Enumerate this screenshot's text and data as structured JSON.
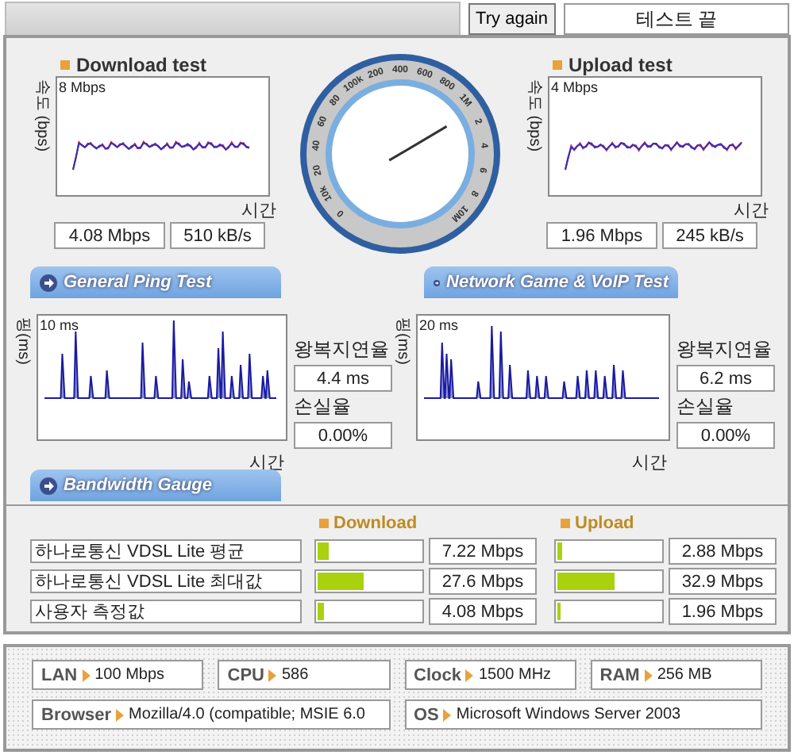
{
  "top_bar": {
    "retry_button": "Try again",
    "status": "테스트 끝"
  },
  "download": {
    "title": "Download test",
    "ylabel": "속도 (bps)",
    "scale": "8 Mbps",
    "xlabel": "시간",
    "rate": "4.08 Mbps",
    "bytes": "510 kB/s"
  },
  "gauge": {
    "labels": [
      "0",
      "10k",
      "20",
      "40",
      "60",
      "80",
      "100k",
      "200",
      "400",
      "600",
      "800",
      "1M",
      "2",
      "4",
      "6",
      "8",
      "10M"
    ],
    "level": 0.72
  },
  "upload": {
    "title": "Upload test",
    "ylabel": "속도 (bps)",
    "scale": "4 Mbps",
    "xlabel": "시간",
    "rate": "1.96 Mbps",
    "bytes": "245 kB/s"
  },
  "section_tabs": [
    "General Ping Test",
    "Network Game & VoIP Test"
  ],
  "ping_panels": [
    {
      "ylabel": "핑(ms)",
      "scale": "10 ms",
      "xlabel": "시간",
      "latency_label": "왕복지연율",
      "latency": "4.4 ms",
      "loss_label": "손실율",
      "loss": "0.00%"
    },
    {
      "ylabel": "핑(ms)",
      "scale": "20 ms",
      "xlabel": "시간",
      "latency_label": "왕복지연율",
      "latency": "6.2 ms",
      "loss_label": "손실율",
      "loss": "0.00%"
    }
  ],
  "bandwidth_tab": "Bandwidth Gauge",
  "bandwidth": {
    "download_label": "Download",
    "upload_label": "Upload",
    "rows": [
      {
        "name": "하나로통신 VDSL Lite 평균",
        "download": {
          "level": 0.11,
          "value": "7.22 Mbps"
        },
        "upload": {
          "level": 0.04,
          "value": "2.88 Mbps"
        }
      },
      {
        "name": "하나로통신 VDSL Lite 최대값",
        "download": {
          "level": 0.45,
          "value": "27.6 Mbps"
        },
        "upload": {
          "level": 0.55,
          "value": "32.9 Mbps"
        }
      },
      {
        "name": "사용자 측정값",
        "download": {
          "level": 0.06,
          "value": "4.08 Mbps"
        },
        "upload": {
          "level": 0.03,
          "value": "1.96 Mbps"
        }
      }
    ]
  },
  "system_info": [
    [
      {
        "label": "LAN",
        "value": "100 Mbps"
      },
      {
        "label": "CPU",
        "value": "586"
      },
      {
        "label": "Clock",
        "value": "1500 MHz"
      },
      {
        "label": "RAM",
        "value": "256 MB"
      }
    ],
    [
      {
        "label": "Browser",
        "value": "Mozilla/4.0 (compatible; MSIE 6.0"
      },
      {
        "label": "OS",
        "value": "Microsoft Windows Server 2003"
      }
    ]
  ]
}
